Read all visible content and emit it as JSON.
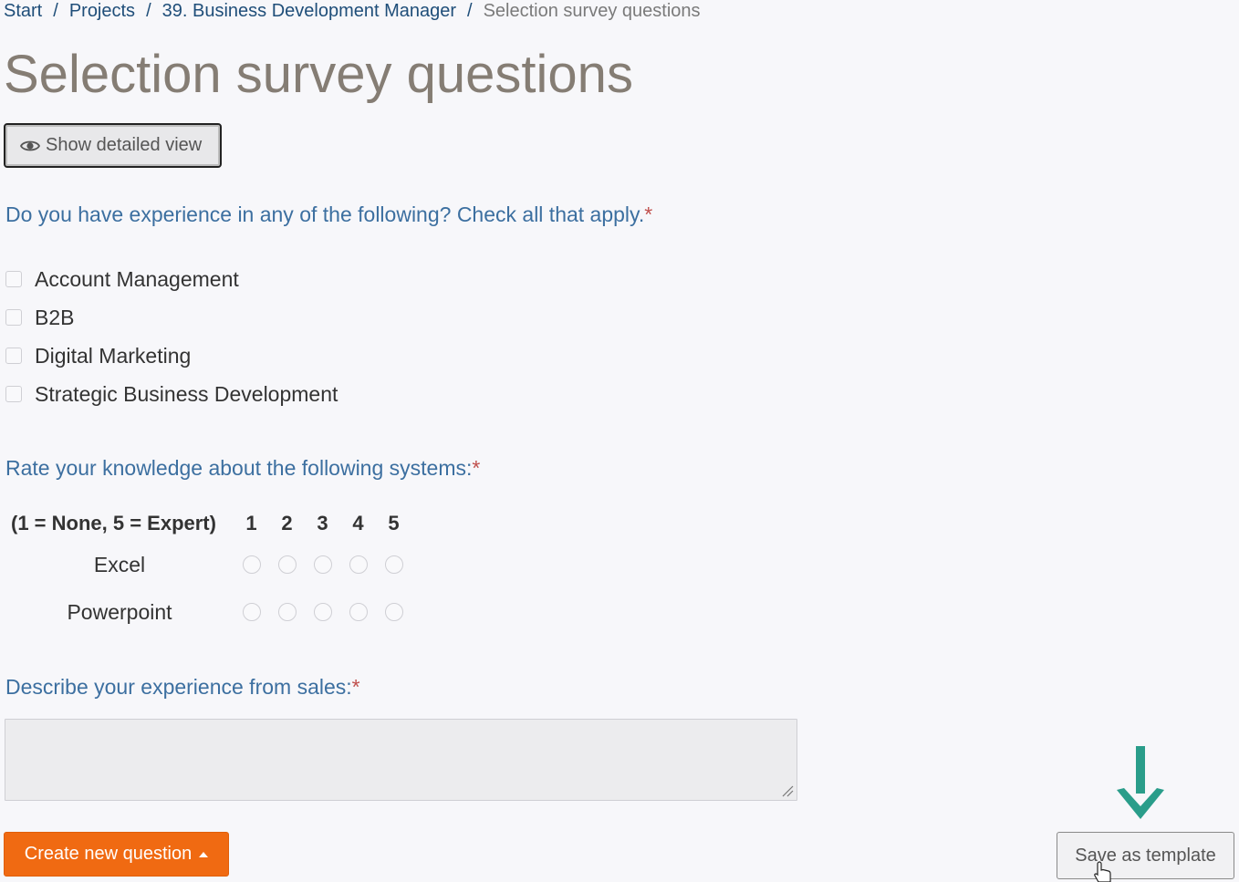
{
  "breadcrumb": {
    "items": [
      "Start",
      "Projects",
      "39. Business Development Manager"
    ],
    "separator": "/",
    "current": "Selection survey questions"
  },
  "page": {
    "title": "Selection survey questions"
  },
  "detail_button": {
    "label": "Show detailed view",
    "icon": "eye-icon"
  },
  "questions": {
    "q1": {
      "text": "Do you have experience in any of the following? Check all that apply.",
      "required_mark": "*",
      "options": [
        "Account Management",
        "B2B",
        "Digital Marketing",
        "Strategic Business Development"
      ]
    },
    "q2": {
      "text": "Rate your knowledge about the following systems:",
      "required_mark": "*",
      "scale_label": "(1 = None, 5 = Expert)",
      "scale": [
        "1",
        "2",
        "3",
        "4",
        "5"
      ],
      "rows": [
        "Excel",
        "Powerpoint"
      ]
    },
    "q3": {
      "text": "Describe your experience from sales:",
      "required_mark": "*",
      "value": ""
    }
  },
  "actions": {
    "create_label": "Create new question",
    "save_template_label": "Save as template"
  },
  "colors": {
    "accent_orange": "#f06a12",
    "question_blue": "#3c6fa0",
    "breadcrumb_blue": "#1f4e79",
    "title_gray": "#857d74",
    "arrow_teal": "#2a9d8a"
  }
}
